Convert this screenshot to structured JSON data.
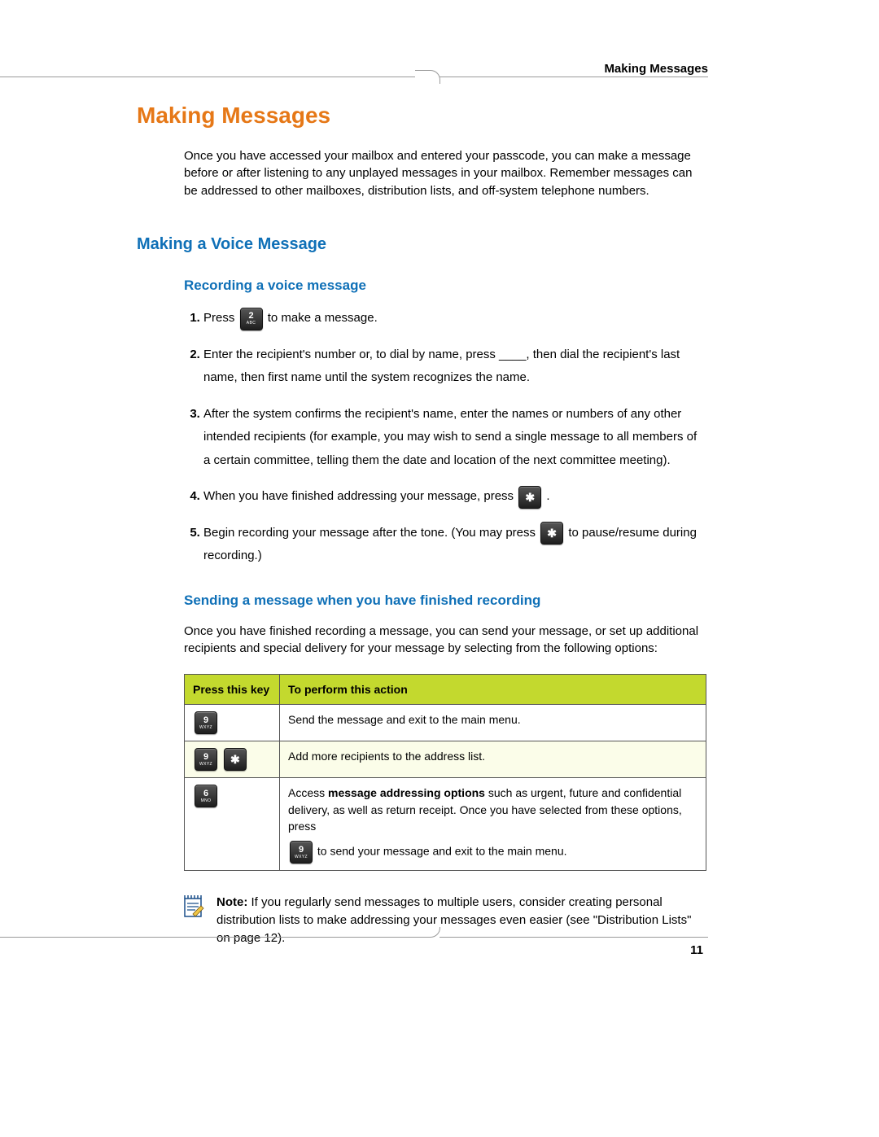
{
  "runningHead": "Making Messages",
  "chapterTitle": "Making Messages",
  "intro": "Once you have accessed your mailbox and entered your passcode, you can make a message before or after listening to any unplayed messages in your mailbox. Remember messages can be addressed to other mailboxes, distribution lists, and off-system telephone numbers.",
  "h2": "Making a Voice Message",
  "h3a": "Recording a voice message",
  "steps": {
    "s1a": "Press ",
    "s1b": " to make a message.",
    "s2": "Enter the recipient's number or, to dial by name, press ____, then dial the recipient's last name, then first name until the system recognizes the name.",
    "s3": "After the system confirms the recipient's name, enter the names or numbers of any other intended recipients (for example, you may wish to send a single message to all members of a certain committee, telling them the date and location of the next committee meeting).",
    "s4a": "When you have finished addressing your message, press ",
    "s4b": " .",
    "s5a": "Begin recording your message after the tone. (You may press ",
    "s5b": " to pause/resume during recording.)"
  },
  "h3b": "Sending a message when you have finished recording",
  "sendIntro": "Once you have finished recording a message, you can send your message, or set up additional recipients and special delivery for your message by selecting from the following options:",
  "table": {
    "h1": "Press this key",
    "h2": "To perform this action",
    "r1": "Send the message and exit to the main menu.",
    "r2": "Add more recipients to the address list.",
    "r3a": "Access ",
    "r3bold": "message addressing options",
    "r3b": " such as urgent, future and confidential delivery, as well as return receipt. Once you have selected from these options, press",
    "r3c": " to send your message and exit to the main menu."
  },
  "keys": {
    "k2": {
      "digit": "2",
      "sub": "ABC"
    },
    "k6": {
      "digit": "6",
      "sub": "MNO"
    },
    "k9": {
      "digit": "9",
      "sub": "WXYZ"
    },
    "star": {
      "digit": "✱",
      "sub": ""
    }
  },
  "note": {
    "label": "Note:",
    "text": " If you regularly send messages to multiple users, consider creating personal distribution lists to make addressing your messages even easier (see \"Distribution Lists\" on page 12)."
  },
  "pageNumber": "11"
}
